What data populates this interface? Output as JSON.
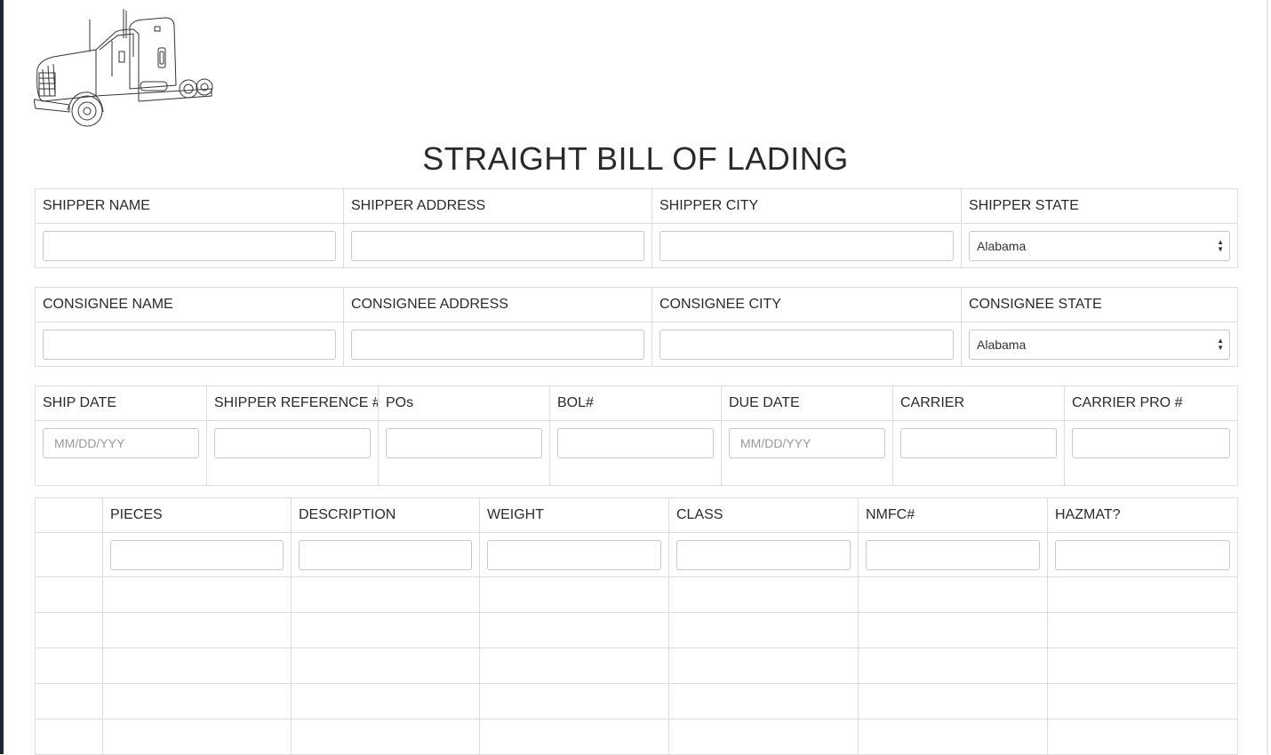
{
  "header": {
    "title": "STRAIGHT BILL OF LADING"
  },
  "shipper": {
    "name_label": "SHIPPER NAME",
    "address_label": "SHIPPER ADDRESS",
    "city_label": "SHIPPER CITY",
    "state_label": "SHIPPER STATE",
    "state_value": "Alabama"
  },
  "consignee": {
    "name_label": "CONSIGNEE NAME",
    "address_label": "CONSIGNEE ADDRESS",
    "city_label": "CONSIGNEE CITY",
    "state_label": "CONSIGNEE STATE",
    "state_value": "Alabama"
  },
  "shipment": {
    "ship_date_label": "SHIP DATE",
    "ship_date_placeholder": "MM/DD/YYY",
    "shipper_ref_label": "SHIPPER REFERENCE #",
    "pos_label": "POs",
    "bol_label": "BOL#",
    "due_date_label": "DUE DATE",
    "due_date_placeholder": "MM/DD/YYY",
    "carrier_label": "CARRIER",
    "carrier_pro_label": "CARRIER PRO #"
  },
  "items": {
    "headers": [
      "",
      "PIECES",
      "DESCRIPTION",
      "WEIGHT",
      "CLASS",
      "NMFC#",
      "HAZMAT?"
    ]
  },
  "colors": {
    "sidebar": "#1d2633",
    "border": "#dcdcdc",
    "input_border": "#c8c8c8"
  },
  "icons": {
    "logo": "truck-logo-icon",
    "select": "chevron-up-down-icon"
  }
}
